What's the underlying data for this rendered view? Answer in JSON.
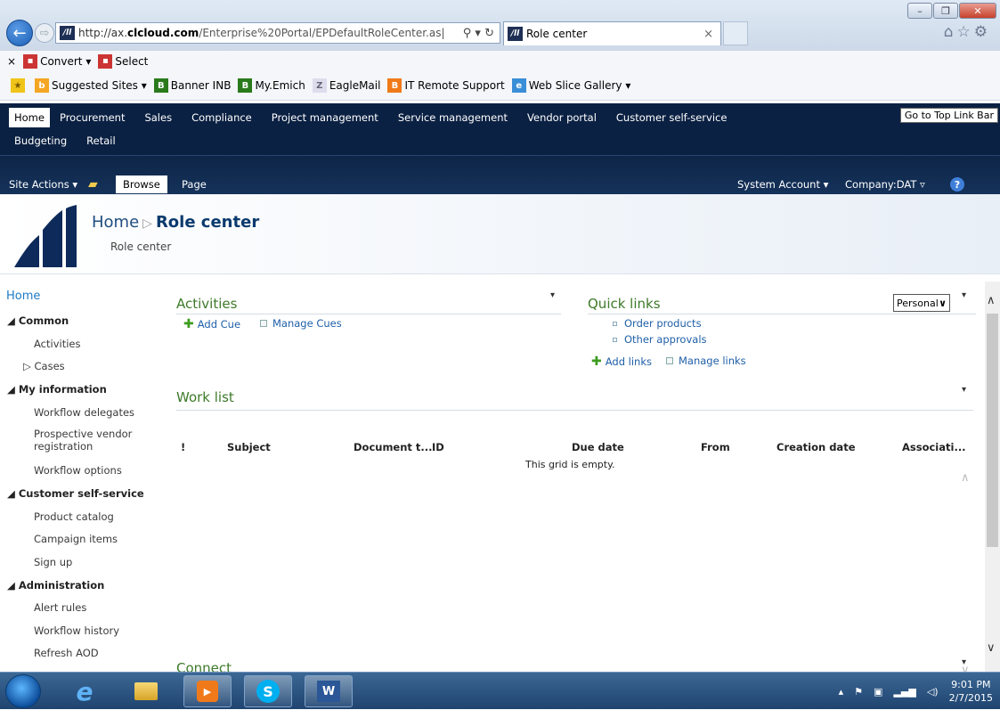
{
  "browser": {
    "url_prefix": "http://ax.",
    "url_host": "clcloud.com",
    "url_tail": "/Enterprise%20Portal/EPDefaultRoleCenter.as|",
    "tab_title": "Role center",
    "tab_close": "×",
    "window_controls": [
      "–",
      "❐",
      "✕"
    ],
    "back_glyph": "←",
    "forward_glyph": "⇨",
    "addr_glyphs": "⚲ ▾ ↻"
  },
  "command_bar": {
    "close": "×",
    "convert_label": "Convert",
    "select_label": "Select"
  },
  "favorites": {
    "items": [
      {
        "label": "Suggested Sites ▾",
        "icon": "bing-icon",
        "color": "#f5a623"
      },
      {
        "label": "Banner INB",
        "icon": "banner-icon",
        "color": "#2a7a1c"
      },
      {
        "label": "My.Emich",
        "icon": "emich-icon",
        "color": "#2a7a1c"
      },
      {
        "label": "EagleMail",
        "icon": "mail-icon",
        "color": "#9aa"
      },
      {
        "label": "IT Remote Support",
        "icon": "bomgar-icon",
        "color": "#f07a1a"
      },
      {
        "label": "Web Slice Gallery ▾",
        "icon": "ie-icon",
        "color": "#3a8ed8"
      }
    ]
  },
  "top_nav": {
    "row1": [
      "Home",
      "Procurement",
      "Sales",
      "Compliance",
      "Project management",
      "Service management",
      "Vendor portal",
      "Customer self-service"
    ],
    "row2": [
      "Budgeting",
      "Retail"
    ],
    "goto": "Go to Top Link Bar"
  },
  "ribbon": {
    "site_actions": "Site Actions ▾",
    "browse": "Browse",
    "page": "Page",
    "account": "System Account ▾",
    "company": "Company:DAT ▿",
    "help": "?"
  },
  "title_area": {
    "home": "Home",
    "separator": "▷",
    "current": "Role center",
    "subtitle": "Role center"
  },
  "left_nav": {
    "home": "Home",
    "groups": [
      {
        "label": "◢ Common",
        "items": [
          "Activities",
          "▷ Cases"
        ]
      },
      {
        "label": "◢ My information",
        "items": [
          "Workflow delegates",
          "Prospective vendor",
          "registration",
          "Workflow options"
        ]
      },
      {
        "label": "◢ Customer self-service",
        "items": [
          "Product catalog",
          "Campaign items",
          "Sign up"
        ]
      },
      {
        "label": "◢ Administration",
        "items": [
          "Alert rules",
          "Workflow history",
          "Refresh AOD"
        ]
      }
    ]
  },
  "activities": {
    "title": "Activities",
    "add_cue": "Add Cue",
    "manage_cues": "Manage Cues"
  },
  "quick_links": {
    "title": "Quick links",
    "personal": "Personal",
    "links": [
      "Order products",
      "Other approvals"
    ],
    "add_links": "Add links",
    "manage_links": "Manage links"
  },
  "work_list": {
    "title": "Work list",
    "columns": [
      "!",
      "Subject",
      "Document t...",
      "ID",
      "Due date",
      "From",
      "Creation date",
      "Associati..."
    ],
    "empty": "This grid is empty."
  },
  "connect": {
    "title": "Connect"
  },
  "taskbar": {
    "time": "9:01 PM",
    "date": "2/7/2015"
  }
}
